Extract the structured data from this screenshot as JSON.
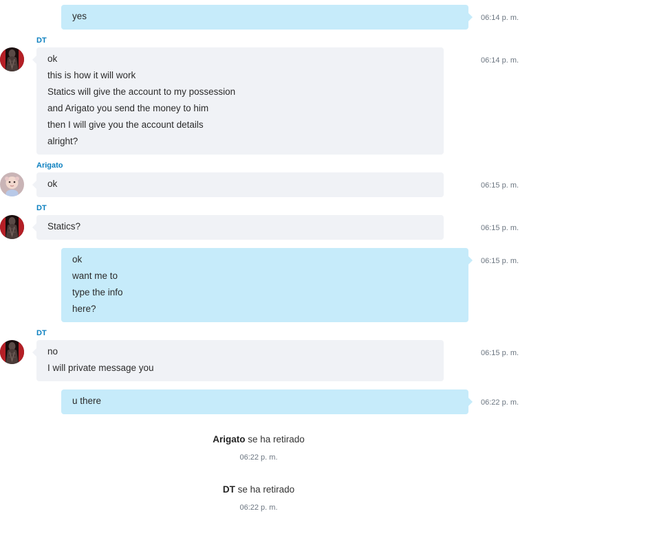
{
  "messages": [
    {
      "direction": "out",
      "lines": [
        "yes"
      ],
      "time": "06:14 p. m."
    },
    {
      "direction": "in",
      "sender": "DT",
      "lines": [
        "ok",
        "this is how it will work",
        "Statics will give the account to my possession",
        "and Arigato you send the money to him",
        "then I will give you the account details",
        "alright?"
      ],
      "time": "06:14 p. m."
    },
    {
      "direction": "in",
      "sender": "Arigato",
      "lines": [
        "ok"
      ],
      "time": "06:15 p. m."
    },
    {
      "direction": "in",
      "sender": "DT",
      "lines": [
        "Statics?"
      ],
      "time": "06:15 p. m."
    },
    {
      "direction": "out",
      "lines": [
        "ok",
        "want me to",
        "type the info",
        "here?"
      ],
      "time": "06:15 p. m."
    },
    {
      "direction": "in",
      "sender": "DT",
      "lines": [
        "no",
        "I will private message you"
      ],
      "time": "06:15 p. m."
    },
    {
      "direction": "out",
      "lines": [
        "u there"
      ],
      "time": "06:22 p. m."
    }
  ],
  "system_events": [
    {
      "name": "Arigato",
      "text": " se ha retirado",
      "time": "06:22 p. m."
    },
    {
      "name": "DT",
      "text": " se ha retirado",
      "time": "06:22 p. m."
    }
  ],
  "avatars": {
    "DT": "dark-figure-avatar-icon",
    "Arigato": "doll-avatar-icon"
  },
  "colors": {
    "outgoing_bubble": "#c6ebfa",
    "incoming_bubble": "#f0f2f6",
    "sender_name": "#0a7fbf",
    "timestamp": "#6b7580"
  }
}
